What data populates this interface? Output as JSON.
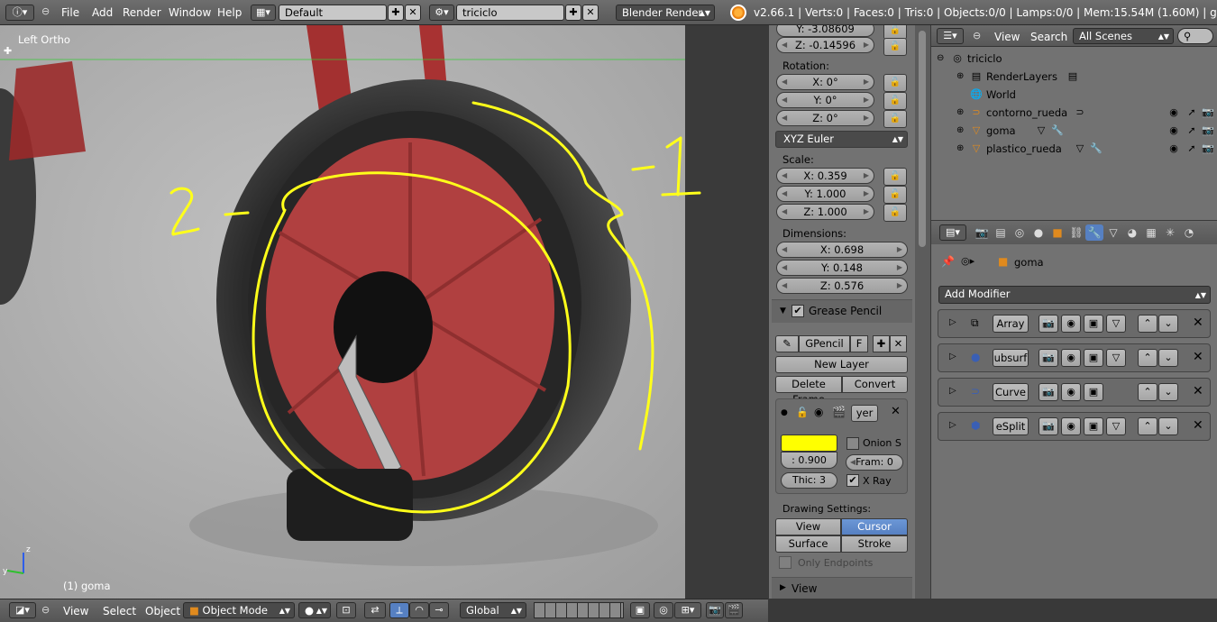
{
  "topbar": {
    "menus": [
      "File",
      "Add",
      "Render",
      "Window",
      "Help"
    ],
    "screen_layout": "Default",
    "scene": "triciclo",
    "render_engine": "Blender Render",
    "status": "v2.66.1 | Verts:0 | Faces:0 | Tris:0 | Objects:0/0 | Lamps:0/0 | Mem:15.54M (1.60M) | goma"
  },
  "viewport": {
    "view_label": "Left Ortho",
    "object_label": "(1) goma",
    "annotation_left": "2 -",
    "annotation_right": "-1"
  },
  "npanel": {
    "loc_y": "Y: -3.08609",
    "loc_z": "Z: -0.14596",
    "rotation_label": "Rotation:",
    "rot_x": "X: 0°",
    "rot_y": "Y: 0°",
    "rot_z": "Z: 0°",
    "rotation_mode": "XYZ Euler",
    "scale_label": "Scale:",
    "scale_x": "X: 0.359",
    "scale_y": "Y: 1.000",
    "scale_z": "Z: 1.000",
    "dimensions_label": "Dimensions:",
    "dim_x": "X: 0.698",
    "dim_y": "Y: 0.148",
    "dim_z": "Z: 0.576",
    "grease_pencil": "Grease Pencil",
    "gpencil_name": "GPencil",
    "gpencil_f": "F",
    "new_layer": "New Layer",
    "delete_frame": "Delete Frame",
    "convert": "Convert",
    "layer_name": "yer",
    "opacity": ": 0.900",
    "onion": "Onion S",
    "frames": "Fram: 0",
    "thickness": "Thic: 3",
    "xray": "X Ray",
    "drawing_settings": "Drawing Settings:",
    "view_btn": "View",
    "cursor_btn": "Cursor",
    "surface_btn": "Surface",
    "stroke_btn": "Stroke",
    "only_endpoints": "Only Endpoints",
    "view_section": "View",
    "stroke_color": "#ffff00"
  },
  "outliner": {
    "view": "View",
    "search": "Search",
    "scenes": "All Scenes",
    "items": [
      "triciclo",
      "RenderLayers",
      "World",
      "contorno_rueda",
      "goma",
      "plastico_rueda"
    ]
  },
  "props": {
    "object_name": "goma",
    "add_modifier": "Add Modifier",
    "modifiers": [
      "Array",
      "ubsurf",
      "Curve",
      "eSplit"
    ]
  },
  "bottombar": {
    "view": "View",
    "select": "Select",
    "object": "Object",
    "mode": "Object Mode",
    "orientation": "Global"
  }
}
